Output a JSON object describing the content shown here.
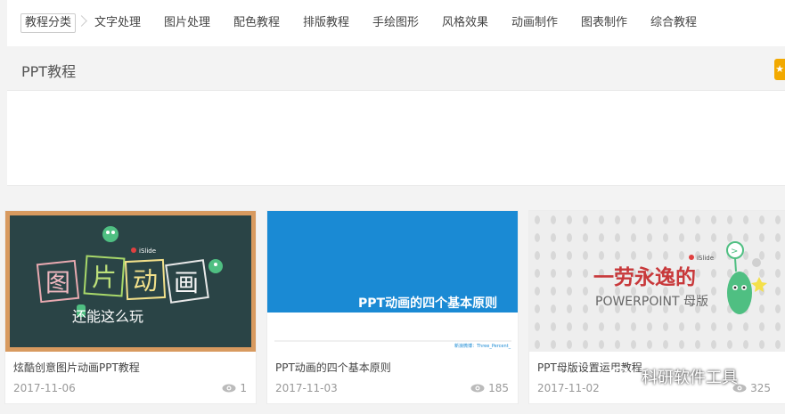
{
  "nav": {
    "items": [
      "教程分类",
      "文字处理",
      "图片处理",
      "配色教程",
      "排版教程",
      "手绘图形",
      "风格效果",
      "动画制作",
      "图表制作",
      "综合教程"
    ]
  },
  "section": {
    "title": "PPT教程",
    "badge_icon": "star-icon"
  },
  "cards": [
    {
      "title": "炫酷创意图片动画PPT教程",
      "date": "2017-11-06",
      "views": "1",
      "thumb": {
        "brand": "iSlide",
        "chars": [
          "图",
          "片",
          "动",
          "画"
        ],
        "subtitle": "还能这么玩"
      }
    },
    {
      "title": "PPT动画的四个基本原则",
      "date": "2017-11-03",
      "views": "185",
      "thumb": {
        "headline": "PPT动画的四个基本原则",
        "footer": "新浪微博：Three_Percent_"
      }
    },
    {
      "title": "PPT母版设置运用教程",
      "date": "2017-11-02",
      "views": "325",
      "thumb": {
        "brand": "iSlide",
        "headline": "一劳永逸的",
        "sub": "POWERPOINT 母版"
      }
    }
  ],
  "watermark": {
    "text": "科研软件工具",
    "icon": "wechat-icon"
  },
  "colors": {
    "chalkboard": "#2a4446",
    "frame": "#d89a5f",
    "blue_banner": "#1a8ad4",
    "red_text": "#c8383a",
    "green_mascot": "#4fbf82",
    "badge": "#f2a900"
  }
}
